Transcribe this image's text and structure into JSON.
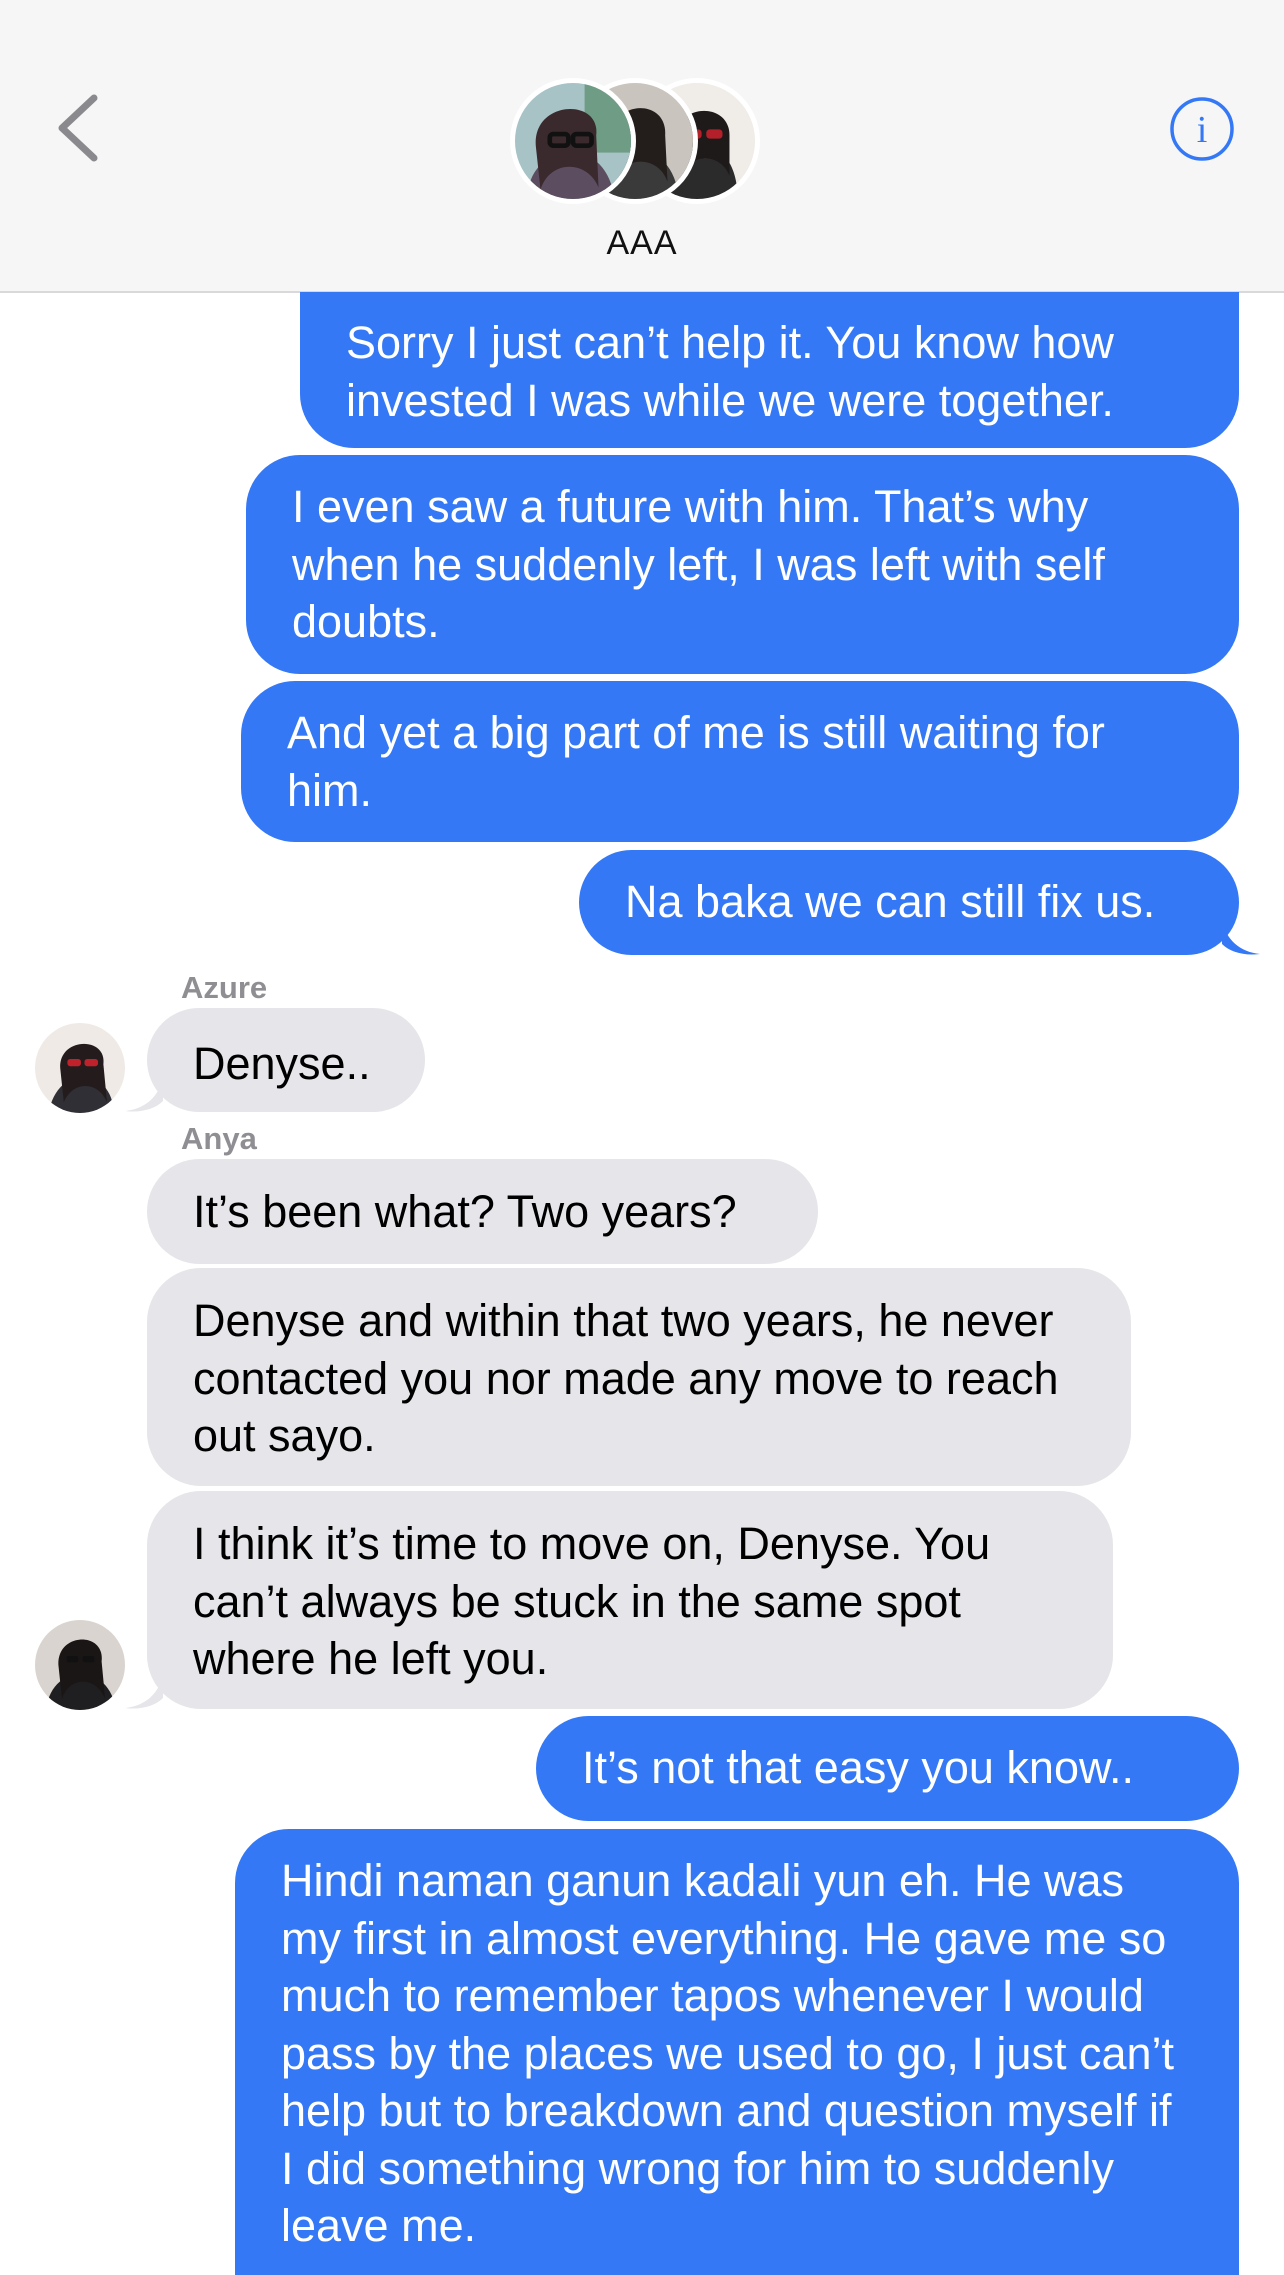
{
  "header": {
    "group_name": "AAA",
    "back_icon": "chevron-left-icon",
    "info_icon": "info-circle-icon",
    "accent_color": "#3478f6"
  },
  "messages": [
    {
      "direction": "outgoing",
      "text": "Sorry I just can’t help it. You know how invested I was while we were together."
    },
    {
      "direction": "outgoing",
      "text": "I even saw a future with him. That’s why when he suddenly left, I was left with self doubts."
    },
    {
      "direction": "outgoing",
      "text": "And yet a big part of me is still waiting for him."
    },
    {
      "direction": "outgoing",
      "text": "Na baka we can still fix us."
    },
    {
      "direction": "incoming",
      "sender": "Azure",
      "text": "Denyse.."
    },
    {
      "direction": "incoming",
      "sender": "Anya",
      "text": "It’s been what? Two years?"
    },
    {
      "direction": "incoming",
      "text": "Denyse and within that two years, he never contacted you nor made any move to reach out sayo."
    },
    {
      "direction": "incoming",
      "text": "I think it’s time to move on, Denyse. You can’t always be stuck in the same spot where he left you."
    },
    {
      "direction": "outgoing",
      "text": "It’s not that easy you know.."
    },
    {
      "direction": "outgoing",
      "text": "Hindi naman ganun kadali yun eh. He was my first in almost everything. He gave me so much to remember tapos whenever I would pass by the places we used to go, I just can’t help but to breakdown and question myself if I did something wrong for him to suddenly leave me."
    }
  ],
  "colors": {
    "outgoing_bubble": "#3478f6",
    "incoming_bubble": "#e5e5ea",
    "header_bg": "#f6f6f6",
    "sender_label": "#8e8e93"
  }
}
